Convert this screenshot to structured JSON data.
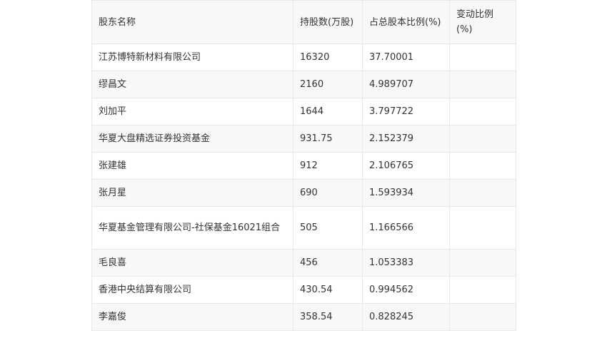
{
  "table": {
    "headers": [
      "股东名称",
      "持股数(万股)",
      "占总股本比例(%)",
      "变动比例(%)"
    ],
    "rows": [
      {
        "name": "江苏博特新材料有限公司",
        "shares": "16320",
        "ratio": "37.70001",
        "change": ""
      },
      {
        "name": "缪昌文",
        "shares": "2160",
        "ratio": "4.989707",
        "change": ""
      },
      {
        "name": "刘加平",
        "shares": "1644",
        "ratio": "3.797722",
        "change": ""
      },
      {
        "name": "华夏大盘精选证券投资基金",
        "shares": "931.75",
        "ratio": "2.152379",
        "change": ""
      },
      {
        "name": "张建雄",
        "shares": "912",
        "ratio": "2.106765",
        "change": ""
      },
      {
        "name": "张月星",
        "shares": "690",
        "ratio": "1.593934",
        "change": ""
      },
      {
        "name": "华夏基金管理有限公司-社保基金16021组合",
        "shares": "505",
        "ratio": "1.166566",
        "change": ""
      },
      {
        "name": "毛良喜",
        "shares": "456",
        "ratio": "1.053383",
        "change": ""
      },
      {
        "name": "香港中央结算有限公司",
        "shares": "430.54",
        "ratio": "0.994562",
        "change": ""
      },
      {
        "name": "李嘉俊",
        "shares": "358.54",
        "ratio": "0.828245",
        "change": ""
      }
    ]
  }
}
